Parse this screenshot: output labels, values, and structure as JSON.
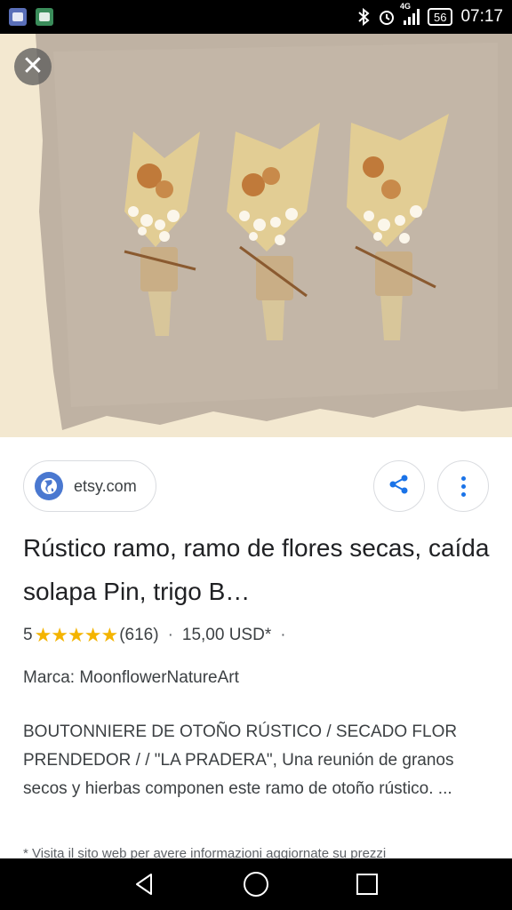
{
  "status_bar": {
    "network": "4G",
    "battery": "56",
    "time": "07:17"
  },
  "photo": {
    "close_icon": "close-icon"
  },
  "card": {
    "source": {
      "label": "etsy.com",
      "icon": "globe-icon"
    },
    "share_icon": "share-icon",
    "more_icon": "more-vert-icon",
    "title": "Rústico ramo, ramo de flores secas, caída solapa Pin, trigo B…",
    "rating": {
      "score": "5",
      "stars": "★★★★★",
      "count": "(616)",
      "price": "15,00 USD*",
      "trailing_dot": "·"
    },
    "brand": "Marca: MoonflowerNatureArt",
    "description": "BOUTONNIERE DE OTOÑO RÚSTICO / SECADO FLOR PRENDEDOR / / \"LA PRADERA\", Una reunión de granos secos y hierbas componen este ramo de otoño rústico. ...",
    "disclaimer": "* Visita il sito web per avere informazioni aggiornate su prezzi"
  },
  "colors": {
    "accent": "#1a73e8",
    "star": "#f4b400",
    "text": "#202124"
  }
}
